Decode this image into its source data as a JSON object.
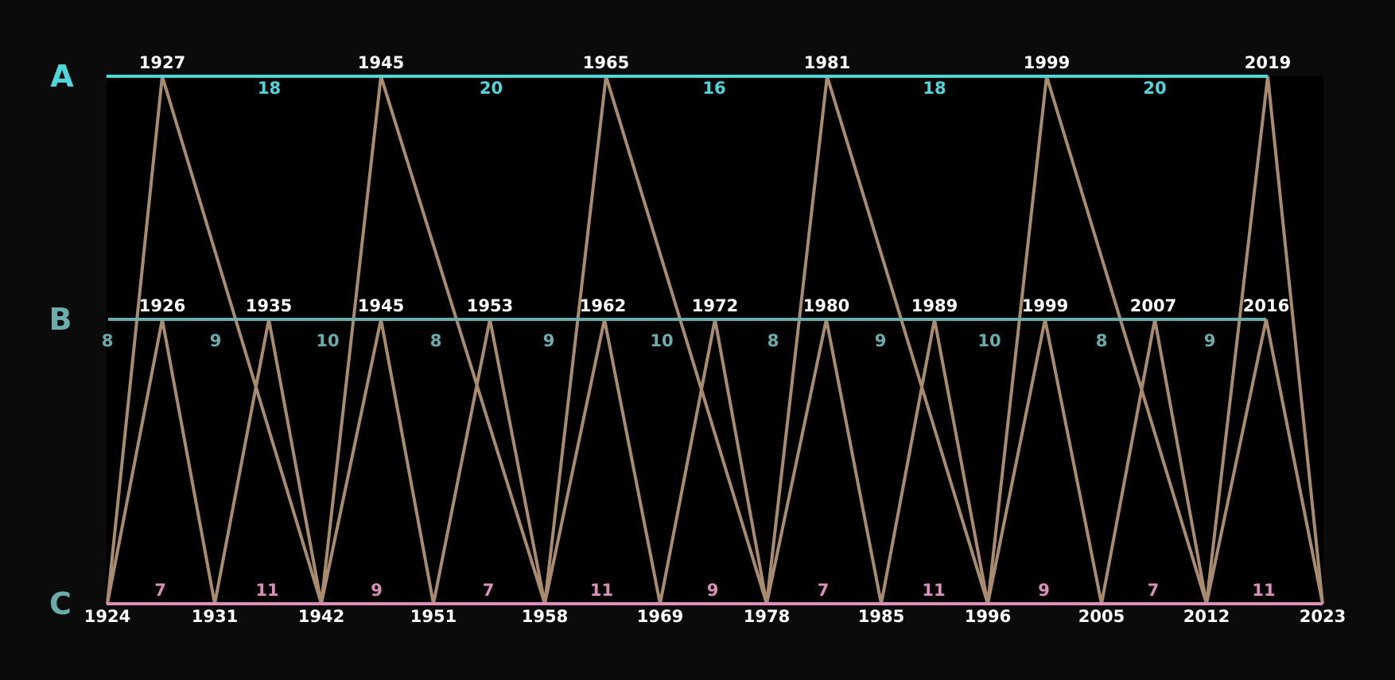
{
  "tracks": {
    "a": {
      "label": "A",
      "years": [
        "1927",
        "1945",
        "1965",
        "1981",
        "1999",
        "2019"
      ],
      "gaps": [
        "18",
        "20",
        "16",
        "18",
        "20"
      ]
    },
    "b": {
      "label": "B",
      "years": [
        "1926",
        "1935",
        "1945",
        "1953",
        "1962",
        "1972",
        "1980",
        "1989",
        "1999",
        "2007",
        "2016"
      ],
      "gaps": [
        "8",
        "9",
        "10",
        "8",
        "9",
        "10",
        "8",
        "9",
        "10",
        "8",
        "9"
      ]
    },
    "c": {
      "label": "C",
      "years": [
        "1924",
        "1931",
        "1942",
        "1951",
        "1958",
        "1969",
        "1978",
        "1985",
        "1996",
        "2005",
        "2012",
        "2023"
      ],
      "gaps": [
        "7",
        "11",
        "9",
        "7",
        "11",
        "9",
        "7",
        "11",
        "9",
        "7",
        "11"
      ]
    }
  },
  "colors": {
    "background": "#0b0b0b",
    "panel": "#000000",
    "track_a": "#4fd5dc",
    "track_b": "#6aadac",
    "track_c": "#dc8fb8",
    "connector": "#a98c70",
    "year_text": "#ffffff"
  }
}
